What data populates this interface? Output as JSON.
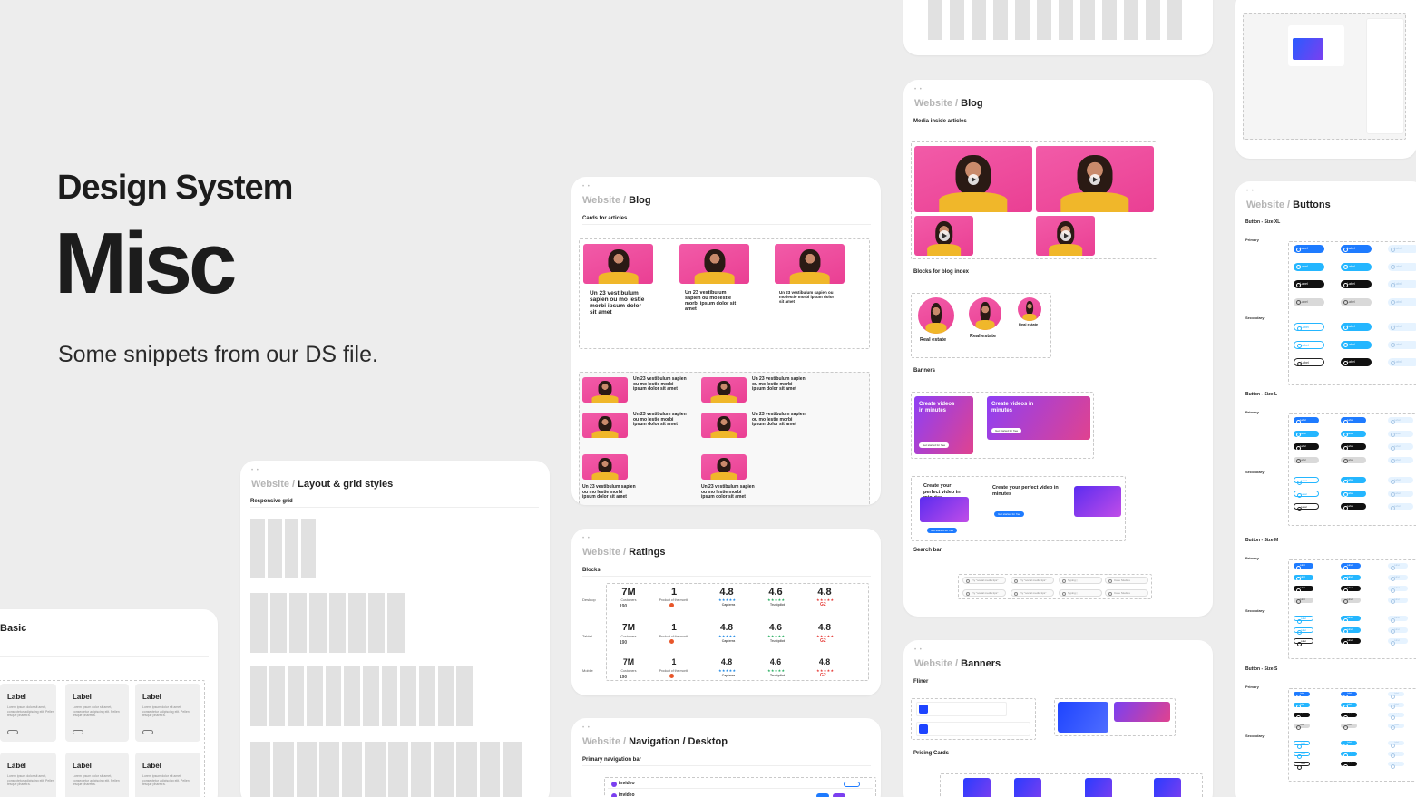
{
  "hero": {
    "kicker": "Design System",
    "title": "Misc",
    "subtitle": "Some snippets from our DS file."
  },
  "common": {
    "website": "Website",
    "sep": " / "
  },
  "blog_cards": {
    "crumb": "Blog",
    "section": "Cards for articles",
    "article_title": "Un 23 vestibulum sapien ou mo lestie morbi ipsum dolor sit amet",
    "article_title_short": "Un 23 vestibulum sapien ou mo lestie morbi ipsum dolor sit amet"
  },
  "blog_media": {
    "crumb": "Blog",
    "section_media": "Media inside articles",
    "section_blocks": "Blocks for blog index",
    "block_label": "Real estate",
    "section_banners": "Banners",
    "banner_headline": "Create videos in minutes",
    "banner_cta": "Get started for free",
    "banner_headline_2": "Create your perfect video in minutes",
    "section_search": "Search bar",
    "search_placeholder": "Try \"social media tips\"",
    "search_typing": "Typing |",
    "search_close": "Case Studies"
  },
  "ratings": {
    "crumb": "Ratings",
    "section": "Blocks",
    "rows": [
      "Desktop",
      "Tablet",
      "Mobile"
    ],
    "customers_value": "7M",
    "customers_label": "Customers",
    "customers_sub": "190",
    "potm_value": "1",
    "potm_label": "Product of the month",
    "values": [
      "4.8",
      "4.6",
      "4.8"
    ],
    "sources": [
      "Capterra",
      "Trustpilot",
      "G2"
    ]
  },
  "layout": {
    "crumb": "Layout & grid styles",
    "section": "Responsive grid"
  },
  "basic": {
    "crumb": "Basic",
    "tile_label": "Label",
    "tile_body": "Lorem ipsum dolor sit amet, consectetur adipiscing elit. Pellen tesque pharetra."
  },
  "buttons": {
    "crumb": "Buttons",
    "sizes": [
      "Button - Size XL",
      "Button - Size L",
      "Button - Size M",
      "Button - Size S"
    ],
    "groups": [
      "Primary",
      "Secondary"
    ],
    "btn_label": "Label"
  },
  "banners": {
    "crumb": "Banners",
    "section": "Fliner",
    "section_pricing": "Pricing Cards"
  },
  "nav": {
    "crumb": "Navigation / Desktop",
    "section": "Primary navigation bar",
    "brand": "invideo"
  }
}
